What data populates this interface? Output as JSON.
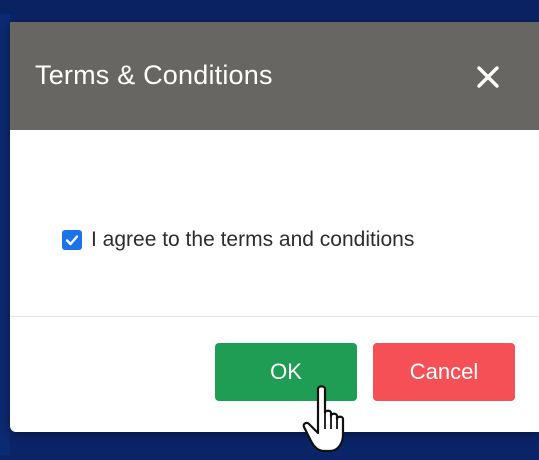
{
  "modal": {
    "title": "Terms & Conditions",
    "close_icon": "close-icon"
  },
  "agreement": {
    "checked": true,
    "label": "I agree to the terms and conditions"
  },
  "footer": {
    "ok_label": "OK",
    "cancel_label": "Cancel"
  },
  "icons": {
    "close": "close-icon",
    "check": "check-icon",
    "cursor": "hand-pointer-icon"
  },
  "colors": {
    "header_bg": "#676662",
    "ok_button": "#1f9d55",
    "cancel_button": "#f45055",
    "checkbox": "#1a73e8",
    "page_bg": "#0b2468"
  }
}
